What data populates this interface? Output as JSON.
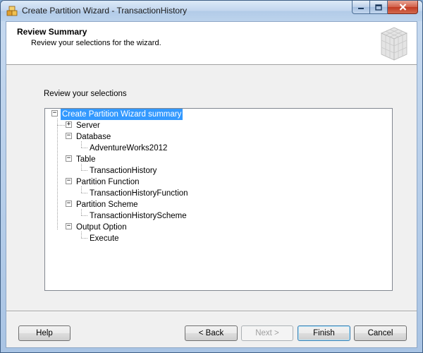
{
  "window": {
    "title": "Create Partition Wizard - TransactionHistory"
  },
  "header": {
    "title": "Review Summary",
    "subtitle": "Review your selections for the wizard."
  },
  "main": {
    "review_label": "Review your selections",
    "tree": {
      "root": "Create Partition Wizard summary",
      "items": [
        {
          "label": "Server"
        },
        {
          "label": "Database",
          "child": "AdventureWorks2012"
        },
        {
          "label": "Table",
          "child": "TransactionHistory"
        },
        {
          "label": "Partition Function",
          "child": "TransactionHistoryFunction"
        },
        {
          "label": "Partition Scheme",
          "child": "TransactionHistoryScheme"
        },
        {
          "label": "Output Option",
          "child": "Execute"
        }
      ]
    }
  },
  "buttons": {
    "help": "Help",
    "back": "< Back",
    "next": "Next >",
    "finish": "Finish",
    "cancel": "Cancel"
  },
  "colors": {
    "selection": "#3399ff",
    "close_button": "#c13a22"
  }
}
